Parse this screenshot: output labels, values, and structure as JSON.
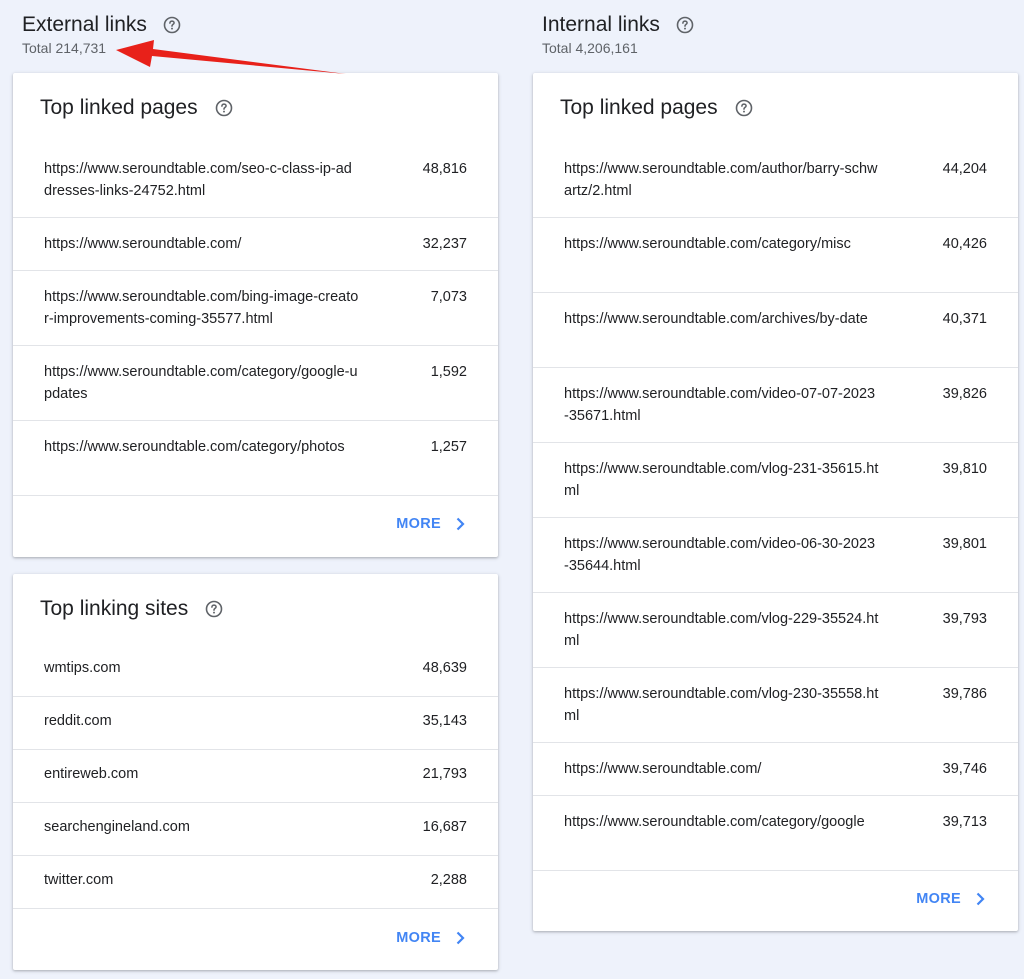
{
  "external": {
    "title": "External links",
    "total": "Total 214,731",
    "top_linked_pages": {
      "title": "Top linked pages",
      "rows": [
        {
          "url": "https://www.seroundtable.com/seo-c-class-ip-addresses-links-24752.html",
          "count": "48,816"
        },
        {
          "url": "https://www.seroundtable.com/",
          "count": "32,237"
        },
        {
          "url": "https://www.seroundtable.com/bing-image-creator-improvements-coming-35577.html",
          "count": "7,073"
        },
        {
          "url": "https://www.seroundtable.com/category/google-updates",
          "count": "1,592"
        },
        {
          "url": "https://www.seroundtable.com/category/photos",
          "count": "1,257"
        }
      ],
      "more_label": "MORE"
    },
    "top_linking_sites": {
      "title": "Top linking sites",
      "rows": [
        {
          "site": "wmtips.com",
          "count": "48,639"
        },
        {
          "site": "reddit.com",
          "count": "35,143"
        },
        {
          "site": "entireweb.com",
          "count": "21,793"
        },
        {
          "site": "searchengineland.com",
          "count": "16,687"
        },
        {
          "site": "twitter.com",
          "count": "2,288"
        }
      ],
      "more_label": "MORE"
    }
  },
  "internal": {
    "title": "Internal links",
    "total": "Total 4,206,161",
    "top_linked_pages": {
      "title": "Top linked pages",
      "rows": [
        {
          "url": "https://www.seroundtable.com/author/barry-schwartz/2.html",
          "count": "44,204"
        },
        {
          "url": "https://www.seroundtable.com/category/misc",
          "count": "40,426"
        },
        {
          "url": "https://www.seroundtable.com/archives/by-date",
          "count": "40,371"
        },
        {
          "url": "https://www.seroundtable.com/video-07-07-2023-35671.html",
          "count": "39,826"
        },
        {
          "url": "https://www.seroundtable.com/vlog-231-35615.html",
          "count": "39,810"
        },
        {
          "url": "https://www.seroundtable.com/video-06-30-2023-35644.html",
          "count": "39,801"
        },
        {
          "url": "https://www.seroundtable.com/vlog-229-35524.html",
          "count": "39,793"
        },
        {
          "url": "https://www.seroundtable.com/vlog-230-35558.html",
          "count": "39,786"
        },
        {
          "url": "https://www.seroundtable.com/",
          "count": "39,746"
        },
        {
          "url": "https://www.seroundtable.com/category/google",
          "count": "39,713"
        }
      ],
      "more_label": "MORE"
    }
  },
  "colors": {
    "accent": "#4285f4",
    "annotation_arrow": "#e8211a",
    "background": "#eef2fb"
  },
  "icons": {
    "help": "help-circle-icon",
    "more": "chevron-right-icon",
    "annotation": "red-arrow-annotation"
  }
}
